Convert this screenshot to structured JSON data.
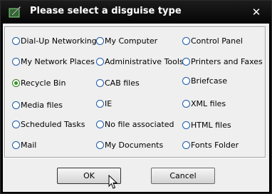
{
  "dialog": {
    "title": "Please select a disguise type",
    "icon": "application-icon",
    "close_label": "✕"
  },
  "options": [
    {
      "label": "Dial-Up Networking",
      "checked": false
    },
    {
      "label": "My Computer",
      "checked": false
    },
    {
      "label": "Control Panel",
      "checked": false
    },
    {
      "label": "My Network Places",
      "checked": false
    },
    {
      "label": "Administrative Tools",
      "checked": false
    },
    {
      "label": "Printers and Faxes",
      "checked": false
    },
    {
      "label": "Recycle Bin",
      "checked": true
    },
    {
      "label": "CAB files",
      "checked": false
    },
    {
      "label": "Briefcase",
      "checked": false
    },
    {
      "label": "Media files",
      "checked": false
    },
    {
      "label": "IE",
      "checked": false
    },
    {
      "label": "XML files",
      "checked": false
    },
    {
      "label": "Scheduled Tasks",
      "checked": false
    },
    {
      "label": "No file associated",
      "checked": false
    },
    {
      "label": "HTML files",
      "checked": false
    },
    {
      "label": "Mail",
      "checked": false
    },
    {
      "label": "My Documents",
      "checked": false
    },
    {
      "label": "Fonts Folder",
      "checked": false
    }
  ],
  "buttons": {
    "ok": "OK",
    "cancel": "Cancel"
  }
}
